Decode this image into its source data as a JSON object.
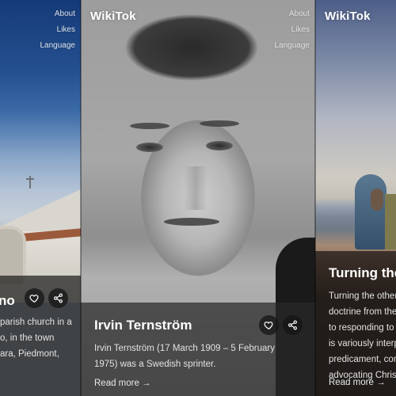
{
  "app": {
    "brand": "WikiTok",
    "nav": [
      "About",
      "Likes",
      "Language"
    ]
  },
  "cards": [
    {
      "position": "previous",
      "title_visible": "no",
      "description_lines": [
        "parish church in a",
        "o, in the town",
        "ara, Piedmont,"
      ],
      "image": "church-photo"
    },
    {
      "position": "current",
      "title": "Irvin Ternström",
      "description": "Irvin Ternström (17 March 1909 – 5 February 1975) was a Swedish sprinter.",
      "read_more": "Read more →",
      "image": "portrait-photo"
    },
    {
      "position": "next",
      "title_visible": "Turning the",
      "description_lines": [
        "Turning the other",
        "doctrine from the",
        "to responding to",
        "is variously interp",
        "predicament, con",
        "advocating Christ"
      ],
      "read_more": "Read more →",
      "image": "painting"
    }
  ],
  "icons": {
    "like": "heart-icon",
    "share": "share-icon"
  }
}
